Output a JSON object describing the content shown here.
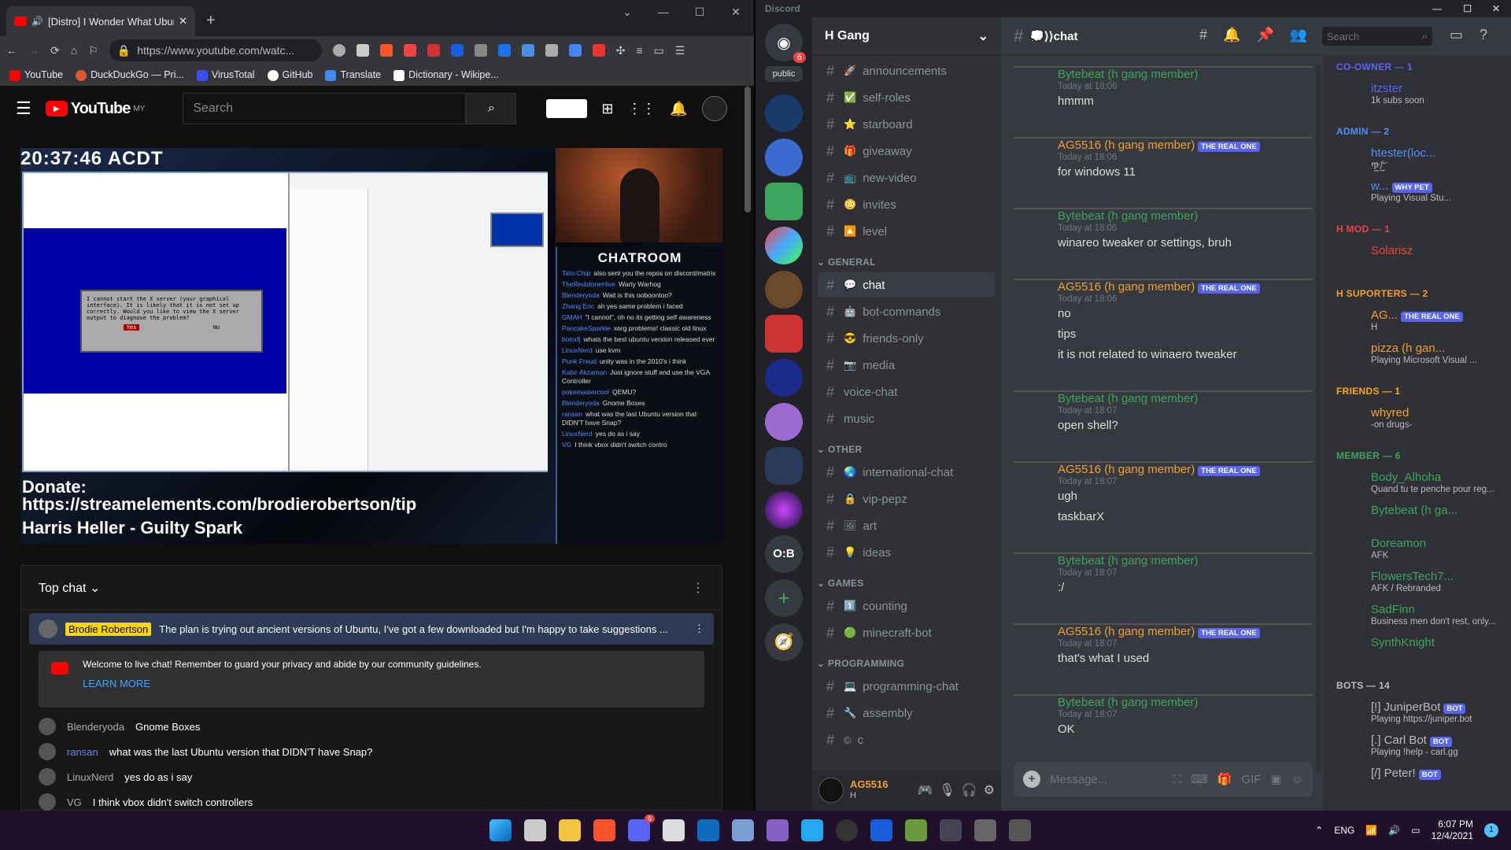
{
  "browser": {
    "tab_title": "[Distro] I Wonder What Ubunt",
    "url": "https://www.youtube.com/watc...",
    "bookmarks": [
      "YouTube",
      "DuckDuckGo — Pri...",
      "VirusTotal",
      "GitHub",
      "Translate",
      "Dictionary - Wikipe..."
    ]
  },
  "youtube": {
    "logo": "YouTube",
    "region": "MY",
    "search_placeholder": "Search",
    "video": {
      "clock": "20:37:46 ACDT",
      "donate_label": "Donate:",
      "donate_url": "https://streamelements.com/brodierobertson/tip",
      "music": "Harris Heller - Guilty Spark",
      "chatroom": "CHATROOM",
      "dialog": "I cannot start the X server (your graphical interface). It is likely that it is not set up correctly. Would you like to view the X server output to diagnose the problem?",
      "dialog_yes": "Yes",
      "dialog_no": "No",
      "overlay_chat": [
        {
          "user": "Tato-Chip",
          "text": "also sent you the repos on discord/matrix"
        },
        {
          "user": "TheRedstoneHive",
          "text": "Warty Warhog"
        },
        {
          "user": "Blenderyoda",
          "text": "Wait is this ooboontoo?"
        },
        {
          "user": "Zhang Eric",
          "text": "ah yes same problem i faced"
        },
        {
          "user": "GMAH",
          "text": "\"I cannot\", oh no its getting self awareness"
        },
        {
          "user": "PancakeSparkle",
          "text": "xorg problems! classic old linux"
        },
        {
          "user": "botorfj",
          "text": "whats the best ubuntu version released ever"
        },
        {
          "user": "LinuxNerd",
          "text": "use kvm"
        },
        {
          "user": "Punk Freud",
          "text": "unity was in the 2010's i think"
        },
        {
          "user": "Kabir Akzaman",
          "text": "Just ignore stuff and use the VGA Controller"
        },
        {
          "user": "pokemastercool",
          "text": "QEMU?"
        },
        {
          "user": "Blenderyoda",
          "text": "Gnome Boxes"
        },
        {
          "user": "ransan",
          "text": "what was the last Ubuntu version that DIDN'T have Snap?"
        },
        {
          "user": "LinuxNerd",
          "text": "yes do as i say"
        },
        {
          "user": "VG",
          "text": "I think vbox didn't switch contro"
        }
      ]
    },
    "chat": {
      "header": "Top chat",
      "pinned_author": "Brodie Robertson",
      "pinned_text": "The plan is trying out ancient versions of Ubuntu, I've got a few downloaded but I'm happy to take suggestions ...",
      "welcome": "Welcome to live chat! Remember to guard your privacy and abide by our community guidelines.",
      "learn_more": "LEARN MORE",
      "messages": [
        {
          "user": "Blenderyoda",
          "text": "Gnome Boxes",
          "color": "#aaaaaa"
        },
        {
          "user": "ransan",
          "text": "what was the last Ubuntu version that DIDN'T have Snap?",
          "color": "#5e84f1"
        },
        {
          "user": "LinuxNerd",
          "text": "yes do as i say",
          "color": "#aaaaaa"
        },
        {
          "user": "VG",
          "text": "I think vbox didn't switch controllers",
          "color": "#aaaaaa"
        }
      ]
    }
  },
  "discord": {
    "app": "Discord",
    "server": "H Gang",
    "badge": "6",
    "public_label": "public",
    "channels": [
      {
        "label": "announcements",
        "emoji": "🚀"
      },
      {
        "label": "self-roles",
        "emoji": "✅"
      },
      {
        "label": "starboard",
        "emoji": "⭐"
      },
      {
        "label": "giveaway",
        "emoji": "🎁"
      },
      {
        "label": "new-video",
        "emoji": "📺"
      },
      {
        "label": "invites",
        "emoji": "😳"
      },
      {
        "label": "level",
        "emoji": "🔼"
      }
    ],
    "categories": [
      "GENERAL",
      "OTHER",
      "GAMES",
      "PROGRAMMING"
    ],
    "general_channels": [
      {
        "label": "chat",
        "emoji": "💬"
      },
      {
        "label": "bot-commands",
        "emoji": "🤖"
      },
      {
        "label": "friends-only",
        "emoji": "😎"
      },
      {
        "label": "media",
        "emoji": "📷"
      },
      {
        "label": "voice-chat",
        "emoji": ""
      },
      {
        "label": "music",
        "emoji": ""
      }
    ],
    "other_channels": [
      {
        "label": "international-chat",
        "emoji": "🌏"
      },
      {
        "label": "vip-pepz",
        "emoji": "🔒"
      },
      {
        "label": "art",
        "emoji": "🖼"
      },
      {
        "label": "ideas",
        "emoji": "💡"
      }
    ],
    "games_channels": [
      {
        "label": "counting",
        "emoji": "1️⃣"
      },
      {
        "label": "minecraft-bot",
        "emoji": "🟢"
      }
    ],
    "programming_channels": [
      {
        "label": "programming-chat",
        "emoji": "💻"
      },
      {
        "label": "assembly",
        "emoji": "🔧"
      },
      {
        "label": "c",
        "emoji": "©"
      }
    ],
    "user": {
      "name": "AG5516",
      "status": "H"
    },
    "chat_title": "💭⟩⟩chat",
    "search": "Search",
    "compose": "Message...",
    "messages": [
      {
        "author": "Bytebeat (h gang member)",
        "time": "Today at 18:06",
        "lines": [
          "hmmm"
        ],
        "color": "#3ba55c",
        "tag": ""
      },
      {
        "author": "AG5516 (h gang member)",
        "time": "Today at 18:06",
        "lines": [
          "for windows 11"
        ],
        "color": "#f0a030",
        "tag": "THE REAL ONE"
      },
      {
        "author": "Bytebeat (h gang member)",
        "time": "Today at 18:06",
        "lines": [
          "winareo tweaker or settings, bruh"
        ],
        "color": "#3ba55c",
        "tag": ""
      },
      {
        "author": "AG5516 (h gang member)",
        "time": "Today at 18:06",
        "lines": [
          "no",
          "tips",
          "it is not related to winaero tweaker"
        ],
        "color": "#f0a030",
        "tag": "THE REAL ONE"
      },
      {
        "author": "Bytebeat (h gang member)",
        "time": "Today at 18:07",
        "lines": [
          "open shell?"
        ],
        "color": "#3ba55c",
        "tag": ""
      },
      {
        "author": "AG5516 (h gang member)",
        "time": "Today at 18:07",
        "lines": [
          "ugh",
          "taskbarX"
        ],
        "color": "#f0a030",
        "tag": "THE REAL ONE"
      },
      {
        "author": "Bytebeat (h gang member)",
        "time": "Today at 18:07",
        "lines": [
          ":/"
        ],
        "color": "#3ba55c",
        "tag": ""
      },
      {
        "author": "AG5516 (h gang member)",
        "time": "Today at 18:07",
        "lines": [
          "that's what I used"
        ],
        "color": "#f0a030",
        "tag": "THE REAL ONE"
      },
      {
        "author": "Bytebeat (h gang member)",
        "time": "Today at 18:07",
        "lines": [
          "OK"
        ],
        "color": "#3ba55c",
        "tag": ""
      }
    ],
    "member_groups": [
      {
        "label": "CO-OWNER — 1",
        "color": "#5865f2",
        "members": [
          {
            "name": "itzster",
            "status": "1k subs soon",
            "color": "#5865f2"
          }
        ]
      },
      {
        "label": "ADMIN — 2",
        "color": "#4f8ff7",
        "members": [
          {
            "name": "htester(loc...",
            "status": "Ͳ̵̛̲ ̸̠͝ ͙̘̈́",
            "color": "#4f8ff7"
          },
          {
            "name": "w...",
            "status": "Playing Visual Stu...",
            "color": "#4f8ff7",
            "tag": "WHY PET"
          }
        ]
      },
      {
        "label": "H MOD — 1",
        "color": "#ed4245",
        "members": [
          {
            "name": "Solarisz",
            "status": "",
            "color": "#ed4245"
          }
        ]
      },
      {
        "label": "H SUPORTERS — 2",
        "color": "#f0a030",
        "members": [
          {
            "name": "AG...",
            "status": "H",
            "color": "#f0a030",
            "tag": "THE REAL ONE"
          },
          {
            "name": "pizza (h gan...",
            "status": "Playing Microsoft Visual ...",
            "color": "#f0a030"
          }
        ]
      },
      {
        "label": "FRIENDS — 1",
        "color": "#faa61a",
        "members": [
          {
            "name": "whyred",
            "status": "-on drugs-",
            "color": "#faa61a"
          }
        ]
      },
      {
        "label": "MEMBER — 6",
        "color": "#3ba55c",
        "members": [
          {
            "name": "Body_Alhoha",
            "status": "Quand tu te penche pour reg...",
            "color": "#3ba55c"
          },
          {
            "name": "Bytebeat (h ga...",
            "status": "",
            "color": "#3ba55c"
          },
          {
            "name": "Doreamon",
            "status": "AFK",
            "color": "#3ba55c"
          },
          {
            "name": "FlowersTech7...",
            "status": "AFK / Rebranded",
            "color": "#3ba55c"
          },
          {
            "name": "SadFinn",
            "status": "Business men don't rest, only...",
            "color": "#3ba55c"
          },
          {
            "name": "SynthKnight",
            "status": "",
            "color": "#3ba55c"
          }
        ]
      },
      {
        "label": "BOTS — 14",
        "color": "#b9bbbe",
        "members": [
          {
            "name": "[!] JuniperBot",
            "status": "Playing https://juniper.bot",
            "color": "#b9bbbe",
            "tag": "BOT"
          },
          {
            "name": "[.] Carl Bot",
            "status": "Playing !help - carl.gg",
            "color": "#b9bbbe",
            "tag": "BOT"
          },
          {
            "name": "[/] Peter!",
            "status": "",
            "color": "#b9bbbe",
            "tag": "BOT"
          }
        ]
      }
    ]
  },
  "taskbar": {
    "lang": "ENG",
    "time": "6:07 PM",
    "date": "12/4/2021",
    "discord_badge": "6"
  }
}
